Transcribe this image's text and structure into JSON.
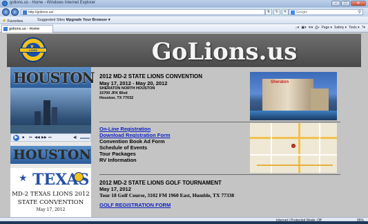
{
  "window": {
    "title": "golions.us - Home - Windows Internet Explorer",
    "controls": [
      "–",
      "□",
      "✕"
    ]
  },
  "address": {
    "url": "http://golions.us/",
    "search_placeholder": "Google"
  },
  "favorites": {
    "label": "Favorites",
    "items": [
      "Suggested Sites ▾",
      "Upgrade Your Browser ▾"
    ]
  },
  "tab": {
    "label": "golions.us - Home"
  },
  "commandbar": {
    "items": [
      "Page ▾",
      "Safety ▾",
      "Tools ▾"
    ]
  },
  "banner": {
    "site_title": "GoLions.us",
    "logo_text": "L",
    "logo_band": "LIONS"
  },
  "left": {
    "houston_word": "HOUSTON",
    "texas_word": "TEXAS",
    "texas_line1": "MD-2 TEXAS LIONS 2012",
    "texas_line2": "STATE CONVENTION",
    "texas_line3": "May 17, 2012"
  },
  "convention": {
    "title": "2012 MD-2 STATE LIONS CONVENTION",
    "dates": "May 17, 2012  -  May 20, 2012",
    "venue": "SHERATON NORTH HOUSTON",
    "street": "15700 JFK Blvd",
    "city": "Houston, TX 77032",
    "hotel_sign": "Sheraton"
  },
  "links": {
    "online_registration": "On-Line Registration",
    "download_form": "Download Registration Form"
  },
  "menu": {
    "items": [
      "Convention Book Ad Form",
      "Schedule of Events",
      "Tour Packages",
      "RV Information"
    ]
  },
  "golf": {
    "title": "2012 MD-2 STATE LIONS GOLF TOURNAMENT",
    "date": "May 17, 2012",
    "course": "Tour 18 Golf Course, 3102 FM 1960 East, Humble, TX  77338",
    "registration_link": "GOLF REGISTRATION FORM"
  },
  "status": {
    "zone": "Internet | Protected Mode: Off",
    "zoom": "95%"
  }
}
